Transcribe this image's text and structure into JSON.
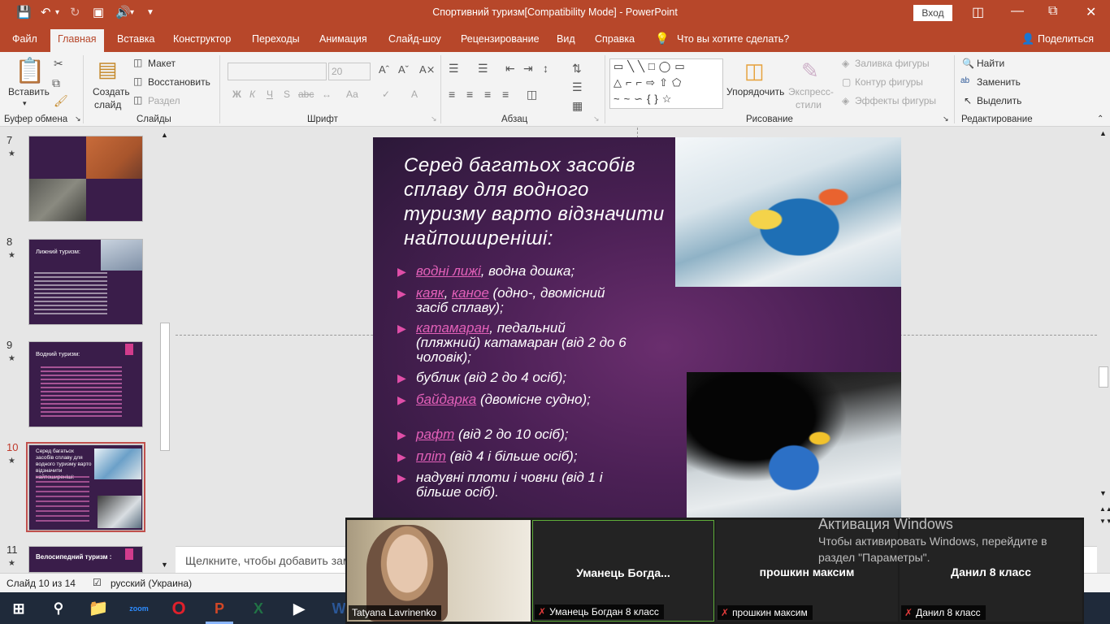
{
  "titlebar": {
    "title": "Спортивний туризм[Compatibility Mode]  -  PowerPoint",
    "signin": "Вход"
  },
  "tabs": [
    "Файл",
    "Главная",
    "Вставка",
    "Конструктор",
    "Переходы",
    "Анимация",
    "Слайд-шоу",
    "Рецензирование",
    "Вид",
    "Справка"
  ],
  "tell_me": "Что вы хотите сделать?",
  "share": "Поделиться",
  "ribbon": {
    "paste": "Вставить",
    "new_slide_1": "Создать",
    "new_slide_2": "слайд",
    "layout": "Макет",
    "reset": "Восстановить",
    "section": "Раздел",
    "font_size": "20",
    "bold": "Ж",
    "italic": "К",
    "underline": "Ч",
    "strike": "S",
    "shadow": "abc",
    "font_case": "Аа",
    "arrange": "Упорядочить",
    "quick_styles_1": "Экспресс-",
    "quick_styles_2": "стили",
    "shape_fill": "Заливка фигуры",
    "shape_outline": "Контур фигуры",
    "shape_effects": "Эффекты фигуры",
    "find": "Найти",
    "replace": "Заменить",
    "select": "Выделить",
    "groups": {
      "clipboard": "Буфер обмена",
      "slides": "Слайды",
      "font": "Шрифт",
      "paragraph": "Абзац",
      "drawing": "Рисование",
      "editing": "Редактирование"
    }
  },
  "thumbnails": [
    {
      "num": "7",
      "title": ""
    },
    {
      "num": "8",
      "title": "Лижний туризм:"
    },
    {
      "num": "9",
      "title": "Водний туризм:"
    },
    {
      "num": "10",
      "title": "Серед багатьох засобів сплаву для водного туризму варто відзначити найпоширеніші:"
    },
    {
      "num": "11",
      "title": "Велосипедний туризм :"
    }
  ],
  "slide": {
    "title": "Серед багатьох засобів сплаву для водного туризму варто відзначити найпоширеніші:",
    "bullets": [
      {
        "link": "водні лижі",
        "rest": ", водна дошка;"
      },
      {
        "link": "каяк",
        "mid": ", ",
        "link2": "каное",
        "rest": " (одно-, двомісний засіб сплаву);"
      },
      {
        "link": "катамаран",
        "rest": ", педальний (пляжний) катамаран (від 2 до 6 чоловік);"
      },
      {
        "link": "",
        "rest": "бублик (від 2 до 4 осіб);"
      },
      {
        "link": "байдарка",
        "rest": " (двомісне судно);"
      },
      {
        "link": "рафт",
        "rest": " (від 2 до 10 осіб);"
      },
      {
        "link": "пліт",
        "rest": " (від 4 і більше осіб);"
      },
      {
        "link": "",
        "rest": "надувні плоти і човни (від 1 і більше осіб)."
      }
    ]
  },
  "notes_placeholder": "Щелкните, чтобы добавить заметки",
  "status": {
    "slide_of": "Слайд 10 из 14",
    "language": "русский (Украина)"
  },
  "zoom": {
    "self_label": "Tatyana Lavrinenko",
    "tiles": [
      {
        "name": "Уманець  Богда...",
        "label": "Уманець Богдан 8 класс"
      },
      {
        "name": "прошкин максим",
        "label": "прошкин максим"
      },
      {
        "name": "Данил 8 класс",
        "label": "Данил 8 класс"
      }
    ]
  },
  "activation": {
    "title": "Активация Windows",
    "line1": "Чтобы активировать Windows, перейдите в",
    "line2": "раздел \"Параметры\"."
  },
  "colors": {
    "accent": "#b7472a",
    "slide_bg": "#4b2055",
    "bullet": "#e04ea8"
  }
}
